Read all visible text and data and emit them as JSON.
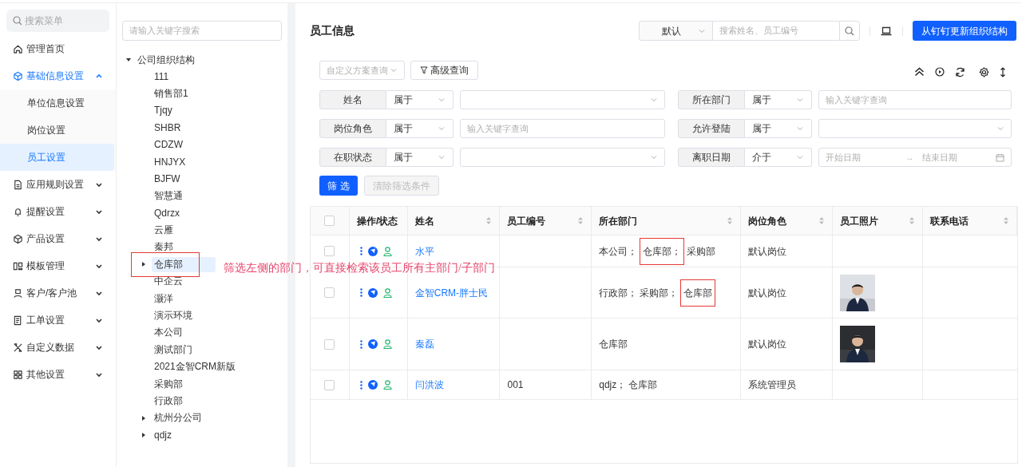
{
  "sidebar": {
    "search": {
      "placeholder": "搜索菜单"
    },
    "items": [
      {
        "label": "管理首页",
        "kind": "link",
        "selected": false
      },
      {
        "label": "基础信息设置",
        "kind": "group",
        "selected": true,
        "expanded": true,
        "children": [
          {
            "label": "单位信息设置",
            "selected": false
          },
          {
            "label": "岗位设置",
            "selected": false
          },
          {
            "label": "员工设置",
            "selected": true
          }
        ]
      },
      {
        "label": "应用规则设置",
        "kind": "group",
        "selected": false,
        "expanded": false
      },
      {
        "label": "提醒设置",
        "kind": "group",
        "selected": false,
        "expanded": false
      },
      {
        "label": "产品设置",
        "kind": "group",
        "selected": false,
        "expanded": false
      },
      {
        "label": "模板管理",
        "kind": "group",
        "selected": false,
        "expanded": false
      },
      {
        "label": "客户/客户池",
        "kind": "group",
        "selected": false,
        "expanded": false
      },
      {
        "label": "工单设置",
        "kind": "group",
        "selected": false,
        "expanded": false
      },
      {
        "label": "自定义数据",
        "kind": "group",
        "selected": false,
        "expanded": false
      },
      {
        "label": "其他设置",
        "kind": "group",
        "selected": false,
        "expanded": false
      }
    ]
  },
  "org_tree": {
    "search": {
      "placeholder": "请输入关键字搜索"
    },
    "root": {
      "label": "公司组织结构",
      "expanded": true,
      "children": [
        {
          "label": "111",
          "has_children": false,
          "selected": false,
          "boxed": false
        },
        {
          "label": "销售部1",
          "has_children": false,
          "selected": false,
          "boxed": false
        },
        {
          "label": "Tjqy",
          "has_children": false,
          "selected": false,
          "boxed": false
        },
        {
          "label": "SHBR",
          "has_children": false,
          "selected": false,
          "boxed": false
        },
        {
          "label": "CDZW",
          "has_children": false,
          "selected": false,
          "boxed": false
        },
        {
          "label": "HNJYX",
          "has_children": false,
          "selected": false,
          "boxed": false
        },
        {
          "label": "BJFW",
          "has_children": false,
          "selected": false,
          "boxed": false
        },
        {
          "label": "智慧通",
          "has_children": false,
          "selected": false,
          "boxed": false
        },
        {
          "label": "Qdrzx",
          "has_children": false,
          "selected": false,
          "boxed": false
        },
        {
          "label": "云雁",
          "has_children": false,
          "selected": false,
          "boxed": false
        },
        {
          "label": "秦邦",
          "has_children": false,
          "selected": false,
          "boxed": false
        },
        {
          "label": "仓库部",
          "has_children": true,
          "selected": true,
          "boxed": true
        },
        {
          "label": "中企云",
          "has_children": false,
          "selected": false,
          "boxed": false
        },
        {
          "label": "灏洋",
          "has_children": false,
          "selected": false,
          "boxed": false
        },
        {
          "label": "演示环境",
          "has_children": false,
          "selected": false,
          "boxed": false
        },
        {
          "label": "本公司",
          "has_children": false,
          "selected": false,
          "boxed": false
        },
        {
          "label": "测试部门",
          "has_children": false,
          "selected": false,
          "boxed": false
        },
        {
          "label": "2021金智CRM新版",
          "has_children": false,
          "selected": false,
          "boxed": false
        },
        {
          "label": "采购部",
          "has_children": false,
          "selected": false,
          "boxed": false
        },
        {
          "label": "行政部",
          "has_children": false,
          "selected": false,
          "boxed": false
        },
        {
          "label": "杭州分公司",
          "has_children": true,
          "selected": false,
          "boxed": false
        },
        {
          "label": "qdjz",
          "has_children": true,
          "selected": false,
          "boxed": false
        }
      ]
    }
  },
  "annotation": {
    "text": "筛选左侧的部门，可直接检索该员工所有主部门/子部门"
  },
  "header": {
    "title": "员工信息",
    "scope_select": "默认",
    "search": {
      "placeholder": "搜索姓名、员工编号"
    },
    "sync_button": "从钉钉更新组织结构"
  },
  "toolbar": {
    "scheme_select": {
      "placeholder": "自定义方案查询"
    },
    "advanced_button": "高级查询"
  },
  "filters": [
    {
      "label": "姓名",
      "operator": "属于",
      "kind": "select"
    },
    {
      "label": "所在部门",
      "operator": "属于",
      "kind": "text",
      "placeholder": "输入关键字查询"
    },
    {
      "label": "岗位角色",
      "operator": "属于",
      "kind": "text",
      "placeholder": "输入关键字查询"
    },
    {
      "label": "允许登陆",
      "operator": "属于",
      "kind": "select"
    },
    {
      "label": "在职状态",
      "operator": "属于",
      "kind": "select"
    },
    {
      "label": "离职日期",
      "operator": "介于",
      "kind": "daterange",
      "start_placeholder": "开始日期",
      "separator": "→",
      "end_placeholder": "结束日期"
    }
  ],
  "filter_button": "筛 选",
  "clear_button": {
    "label": "清除筛选条件",
    "disabled": true
  },
  "table": {
    "header_checked": false,
    "columns": [
      {
        "label": "操作/状态",
        "sortable": false
      },
      {
        "label": "姓名",
        "sortable": true
      },
      {
        "label": "员工编号",
        "sortable": true
      },
      {
        "label": "所在部门",
        "sortable": true
      },
      {
        "label": "岗位角色",
        "sortable": true
      },
      {
        "label": "员工照片",
        "sortable": true
      },
      {
        "label": "联系电话",
        "sortable": true
      }
    ],
    "rows": [
      {
        "checked": false,
        "name": "水平",
        "departments": [
          {
            "name": "本公司；",
            "boxed": false
          },
          {
            "name": "仓库部；",
            "boxed": true
          },
          {
            "name": "采购部",
            "boxed": false
          }
        ],
        "role": "默认岗位"
      },
      {
        "checked": false,
        "name": "金智CRM-胖士民",
        "departments": [
          {
            "name": "行政部；",
            "boxed": false
          },
          {
            "name": "采购部；",
            "boxed": false
          },
          {
            "name": "仓库部",
            "boxed": true
          }
        ],
        "role": "默认岗位",
        "photo": {
          "kind": "picture"
        }
      },
      {
        "checked": false,
        "name": "秦磊",
        "departments": [
          {
            "name": "仓库部",
            "boxed": false
          }
        ],
        "role": "默认岗位",
        "photo": {
          "kind": "picture"
        }
      },
      {
        "checked": false,
        "name": "闫洪波",
        "number": "001",
        "departments": [
          {
            "name": "qdjz；",
            "boxed": false
          },
          {
            "name": "仓库部",
            "boxed": false
          }
        ],
        "role": "系统管理员"
      }
    ]
  }
}
